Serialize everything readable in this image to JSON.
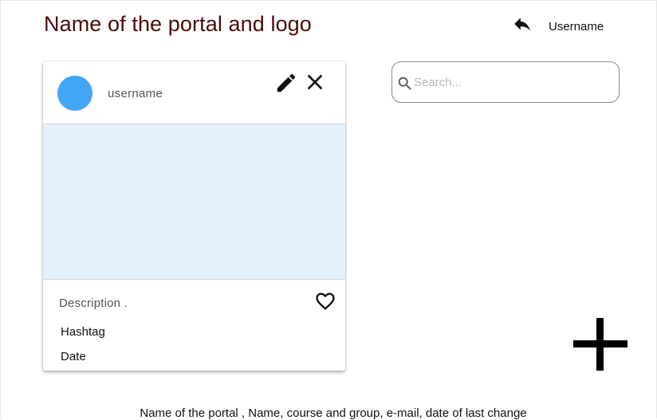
{
  "header": {
    "title": "Name of the portal and logo",
    "username": "Username",
    "back_icon": "reply-arrow-icon"
  },
  "search": {
    "placeholder": "Search...",
    "value": "",
    "icon": "search-icon"
  },
  "card": {
    "username": "username",
    "avatar_color": "#42a5f5",
    "media_color": "#e3f0fc",
    "description": "Description .",
    "hashtag": "Hashtag",
    "date": "Date",
    "actions": [
      "edit-icon",
      "close-icon",
      "heart-icon"
    ]
  },
  "fab": {
    "icon": "plus-icon"
  },
  "footer": {
    "text": "Name of the portal , Name, course and group, e-mail, date of last change"
  }
}
